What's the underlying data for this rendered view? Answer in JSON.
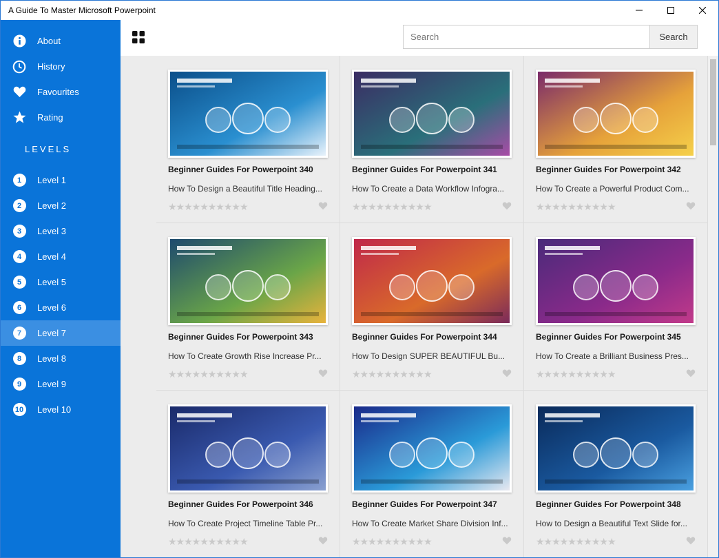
{
  "window": {
    "title": "A Guide To Master Microsoft Powerpoint"
  },
  "sidebar": {
    "menu": [
      {
        "label": "About",
        "icon": "info-icon"
      },
      {
        "label": "History",
        "icon": "clock-icon"
      },
      {
        "label": "Favourites",
        "icon": "heart-icon"
      },
      {
        "label": "Rating",
        "icon": "star-icon"
      }
    ],
    "levels_heading": "LEVELS",
    "levels": [
      {
        "num": "1",
        "label": "Level 1"
      },
      {
        "num": "2",
        "label": "Level 2"
      },
      {
        "num": "3",
        "label": "Level 3"
      },
      {
        "num": "4",
        "label": "Level 4"
      },
      {
        "num": "5",
        "label": "Level 5"
      },
      {
        "num": "6",
        "label": "Level 6"
      },
      {
        "num": "7",
        "label": "Level 7",
        "active": true
      },
      {
        "num": "8",
        "label": "Level 8"
      },
      {
        "num": "9",
        "label": "Level 9"
      },
      {
        "num": "10",
        "label": "Level 10"
      }
    ],
    "accent": "#0a74d9",
    "active_color": "#3b8fe2"
  },
  "toolbar": {
    "search_placeholder": "Search",
    "search_button": "Search"
  },
  "cards": [
    {
      "title": "Beginner Guides For Powerpoint 340",
      "subtitle": "How To Design a Beautiful Title Heading...",
      "stars": "★★★★★★★★★★",
      "thumb": [
        "#0b4f8a",
        "#2a8fd0",
        "#e8f2fb"
      ]
    },
    {
      "title": "Beginner Guides For Powerpoint 341",
      "subtitle": "How To Create a Data Workflow Infogra...",
      "stars": "★★★★★★★★★★",
      "thumb": [
        "#3b2c63",
        "#2a6f7a",
        "#a84ca6"
      ]
    },
    {
      "title": "Beginner Guides For Powerpoint 342",
      "subtitle": "How To Create a Powerful Product Com...",
      "stars": "★★★★★★★★★★",
      "thumb": [
        "#7a2a6a",
        "#e6a23a",
        "#f5d04a"
      ]
    },
    {
      "title": "Beginner Guides For Powerpoint 343",
      "subtitle": "How To Create Growth Rise Increase Pr...",
      "stars": "★★★★★★★★★★",
      "thumb": [
        "#1e4a6e",
        "#6aa548",
        "#e8b33c"
      ]
    },
    {
      "title": "Beginner Guides For Powerpoint 344",
      "subtitle": "How To Design SUPER BEAUTIFUL Bu...",
      "stars": "★★★★★★★★★★",
      "thumb": [
        "#c0284a",
        "#d96a2a",
        "#7a2a5a"
      ]
    },
    {
      "title": "Beginner Guides For Powerpoint 345",
      "subtitle": "How To Create a Brilliant Business Pres...",
      "stars": "★★★★★★★★★★",
      "thumb": [
        "#4a2a7a",
        "#8a2a8a",
        "#c23a8a"
      ]
    },
    {
      "title": "Beginner Guides For Powerpoint 346",
      "subtitle": "How To Create Project Timeline Table Pr...",
      "stars": "★★★★★★★★★★",
      "thumb": [
        "#1a2a6a",
        "#3a5ab0",
        "#8aa0d0"
      ]
    },
    {
      "title": "Beginner Guides For Powerpoint 347",
      "subtitle": "How To Create Market Share Division Inf...",
      "stars": "★★★★★★★★★★",
      "thumb": [
        "#1a2a8a",
        "#2a9ad8",
        "#e8e8f0"
      ]
    },
    {
      "title": "Beginner Guides For Powerpoint 348",
      "subtitle": "How to Design a Beautiful Text Slide for...",
      "stars": "★★★★★★★★★★",
      "thumb": [
        "#0a2a5a",
        "#1a5aa0",
        "#4aa0e0"
      ]
    }
  ]
}
